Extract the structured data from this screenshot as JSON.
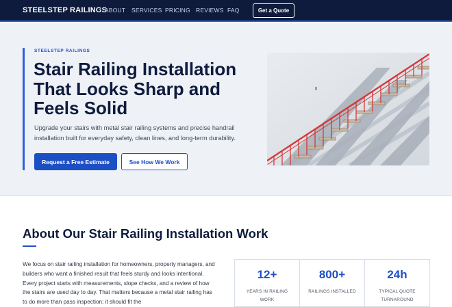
{
  "nav": {
    "brand": "STEELSTEP RAILINGS",
    "links": [
      "ABOUT",
      "SERVICES",
      "PRICING",
      "REVIEWS",
      "FAQ"
    ],
    "cta": "Get a Quote"
  },
  "hero": {
    "eyebrow": "STEELSTEP RAILINGS",
    "title": "Stair Railing Installation That Looks Sharp and Feels Solid",
    "subtitle": "Upgrade your stairs with metal stair railing systems and precise handrail installation built for everyday safety, clean lines, and long-term durability.",
    "primary_button": "Request a Free Estimate",
    "secondary_button": "See How We Work",
    "image_icon": "stair-railing-photo"
  },
  "about": {
    "title": "About Our Stair Railing Installation Work",
    "body": "We focus on stair railing installation for homeowners, property managers, and builders who want a finished result that feels sturdy and looks intentional. Every project starts with measurements, slope checks, and a review of how the stairs are used day to day. That matters because a metal stair railing has to do more than pass inspection; it should fit the"
  },
  "stats": [
    {
      "value": "12+",
      "label": "YEARS IN RAILING WORK"
    },
    {
      "value": "800+",
      "label": "RAILINGS INSTALLED"
    },
    {
      "value": "24h",
      "label": "TYPICAL QUOTE TURNAROUND"
    }
  ],
  "colors": {
    "nav_bg": "#0f1b3d",
    "accent": "#1d4fc4",
    "hero_bg": "#eef2f7",
    "railing": "#d23a3a"
  }
}
